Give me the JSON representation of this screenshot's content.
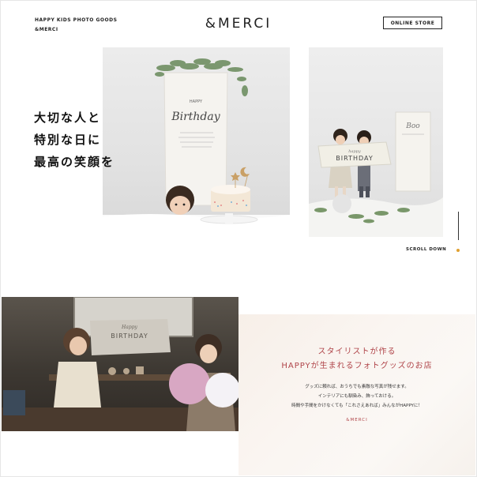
{
  "header": {
    "tagline_line1": "HAPPY KIDS PHOTO GOODS",
    "tagline_line2": "&MERCI",
    "logo": "&MERCI",
    "online_store_label": "ONLINE STORE"
  },
  "hero": {
    "catch_lines": [
      "大切な人と",
      "特別な日に",
      "最高の笑顔を"
    ],
    "banner_left_line1": "HAPPY",
    "banner_left_line2": "Birthday",
    "banner_right_line1": "happy",
    "banner_right_line2": "BIRTHDAY",
    "poster_right": "Boo",
    "scroll_label": "SCROLL DOWN"
  },
  "shop": {
    "photo_banner_line1": "Happy",
    "photo_banner_line2": "BIRTHDAY",
    "title_line1": "スタイリストが作る",
    "title_line2": "HAPPYが生まれるフォトグッズのお店",
    "desc_lines": [
      "グッズに頼れば、おうちでも素敵な写真が残せます。",
      "インテリアにも馴染み、飾っておける。",
      "時間や手間をかけなくても「これさえあれば」みんながHAPPYに！"
    ],
    "brand": "&MERCI"
  },
  "colors": {
    "accent_red": "#b0454a",
    "scroll_dot": "#e0a030"
  }
}
